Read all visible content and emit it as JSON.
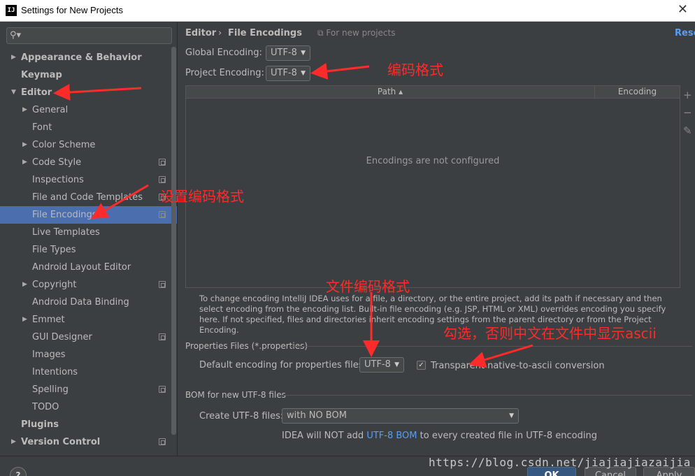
{
  "window": {
    "title": "Settings for New Projects",
    "app_icon": "IJ"
  },
  "search": {
    "placeholder": ""
  },
  "sidebar": {
    "items": [
      {
        "label": "Appearance & Behavior",
        "bold": true,
        "arrow": "right",
        "copy": false
      },
      {
        "label": "Keymap",
        "bold": true,
        "arrow": "",
        "copy": false
      },
      {
        "label": "Editor",
        "bold": true,
        "arrow": "down",
        "copy": false
      },
      {
        "label": "General",
        "bold": false,
        "arrow": "right",
        "copy": false
      },
      {
        "label": "Font",
        "bold": false,
        "arrow": "",
        "copy": false
      },
      {
        "label": "Color Scheme",
        "bold": false,
        "arrow": "right",
        "copy": false
      },
      {
        "label": "Code Style",
        "bold": false,
        "arrow": "right",
        "copy": true
      },
      {
        "label": "Inspections",
        "bold": false,
        "arrow": "",
        "copy": true
      },
      {
        "label": "File and Code Templates",
        "bold": false,
        "arrow": "",
        "copy": true
      },
      {
        "label": "File Encodings",
        "bold": false,
        "arrow": "",
        "copy": true,
        "selected": true
      },
      {
        "label": "Live Templates",
        "bold": false,
        "arrow": "",
        "copy": false
      },
      {
        "label": "File Types",
        "bold": false,
        "arrow": "",
        "copy": false
      },
      {
        "label": "Android Layout Editor",
        "bold": false,
        "arrow": "",
        "copy": false
      },
      {
        "label": "Copyright",
        "bold": false,
        "arrow": "right",
        "copy": true
      },
      {
        "label": "Android Data Binding",
        "bold": false,
        "arrow": "",
        "copy": false
      },
      {
        "label": "Emmet",
        "bold": false,
        "arrow": "right",
        "copy": false
      },
      {
        "label": "GUI Designer",
        "bold": false,
        "arrow": "",
        "copy": true
      },
      {
        "label": "Images",
        "bold": false,
        "arrow": "",
        "copy": false
      },
      {
        "label": "Intentions",
        "bold": false,
        "arrow": "",
        "copy": false
      },
      {
        "label": "Spelling",
        "bold": false,
        "arrow": "",
        "copy": true
      },
      {
        "label": "TODO",
        "bold": false,
        "arrow": "",
        "copy": false
      },
      {
        "label": "Plugins",
        "bold": true,
        "arrow": "",
        "copy": false
      },
      {
        "label": "Version Control",
        "bold": true,
        "arrow": "right",
        "copy": true
      }
    ]
  },
  "breadcrumb": {
    "parent": "Editor",
    "separator": "›",
    "current": "File Encodings",
    "note": "For new projects"
  },
  "reset_label": "Reset",
  "global_encoding": {
    "label": "Global Encoding:",
    "value": "UTF-8"
  },
  "project_encoding": {
    "label": "Project Encoding:",
    "value": "UTF-8"
  },
  "table": {
    "col_path": "Path ▴",
    "col_encoding": "Encoding",
    "empty_text": "Encodings are not configured"
  },
  "help_text": "To change encoding IntelliJ IDEA uses for a file, a directory, or the entire project, add its path if necessary and then select encoding from the encoding list. Built-in file encoding (e.g. JSP, HTML or XML) overrides encoding you specify here. If not specified, files and directories inherit encoding settings from the parent directory or from the Project Encoding.",
  "properties": {
    "section_title": "Properties Files (*.properties)",
    "default_label": "Default encoding for properties files:",
    "default_value": "UTF-8",
    "checkbox_checked": true,
    "checkbox_label": "Transparent native-to-ascii conversion"
  },
  "bom": {
    "section_title": "BOM for new UTF-8 files",
    "create_label": "Create UTF-8 files:",
    "create_value": "with NO BOM",
    "note_pre": "IDEA will NOT add ",
    "note_link": "UTF-8 BOM",
    "note_post": " to every created file in UTF-8 encoding"
  },
  "buttons": {
    "help": "?",
    "ok": "OK",
    "cancel": "Cancel",
    "apply": "Apply"
  },
  "watermark": "https://blog.csdn.net/jiajiajiazaijia",
  "annotations": {
    "encoding_format": "编码格式",
    "set_encoding_format": "设置编码格式",
    "file_encoding_format": "文件编码格式",
    "check_note": "勾选，否则中文在文件中显示ascii"
  },
  "colors": {
    "accent": "#4b6eaf",
    "link": "#589df6",
    "annotation": "#ff2a2a",
    "background": "#3c3f41"
  }
}
